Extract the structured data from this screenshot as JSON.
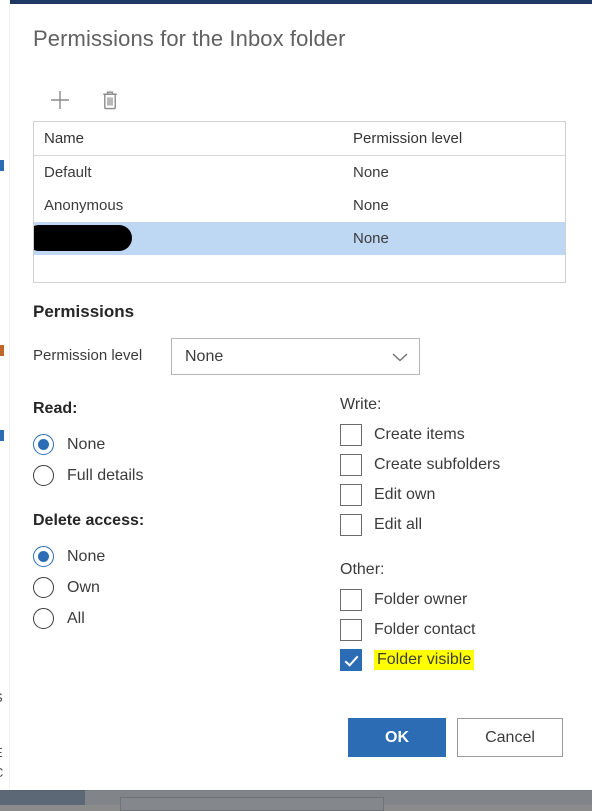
{
  "dialog": {
    "title": "Permissions for the Inbox folder",
    "accent_color": "#1f3864"
  },
  "toolbar": {
    "add_icon": "plus-icon",
    "delete_icon": "trash-icon"
  },
  "table": {
    "columns": [
      "Name",
      "Permission level"
    ],
    "rows": [
      {
        "name": "Default",
        "level": "None",
        "selected": false,
        "redacted": false
      },
      {
        "name": "Anonymous",
        "level": "None",
        "selected": false,
        "redacted": false
      },
      {
        "name": "",
        "level": "None",
        "selected": true,
        "redacted": true
      }
    ]
  },
  "permissions": {
    "heading": "Permissions",
    "level_label": "Permission level",
    "level_value": "None",
    "chevron_icon": "chevron-down-icon"
  },
  "read": {
    "heading": "Read:",
    "options": [
      {
        "label": "None",
        "checked": true
      },
      {
        "label": "Full details",
        "checked": false
      }
    ]
  },
  "delete_access": {
    "heading": "Delete access:",
    "options": [
      {
        "label": "None",
        "checked": true
      },
      {
        "label": "Own",
        "checked": false
      },
      {
        "label": "All",
        "checked": false
      }
    ]
  },
  "write": {
    "heading": "Write:",
    "options": [
      {
        "label": "Create items",
        "checked": false,
        "highlighted": false
      },
      {
        "label": "Create subfolders",
        "checked": false,
        "highlighted": false
      },
      {
        "label": "Edit own",
        "checked": false,
        "highlighted": false
      },
      {
        "label": "Edit all",
        "checked": false,
        "highlighted": false
      }
    ]
  },
  "other": {
    "heading": "Other:",
    "options": [
      {
        "label": "Folder owner",
        "checked": false,
        "highlighted": false
      },
      {
        "label": "Folder contact",
        "checked": false,
        "highlighted": false
      },
      {
        "label": "Folder visible",
        "checked": true,
        "highlighted": true
      }
    ]
  },
  "footer": {
    "ok_label": "OK",
    "cancel_label": "Cancel",
    "ok_color": "#2b6cb4"
  },
  "background": {
    "sliver_texts": [
      "S",
      "E",
      "C"
    ]
  }
}
